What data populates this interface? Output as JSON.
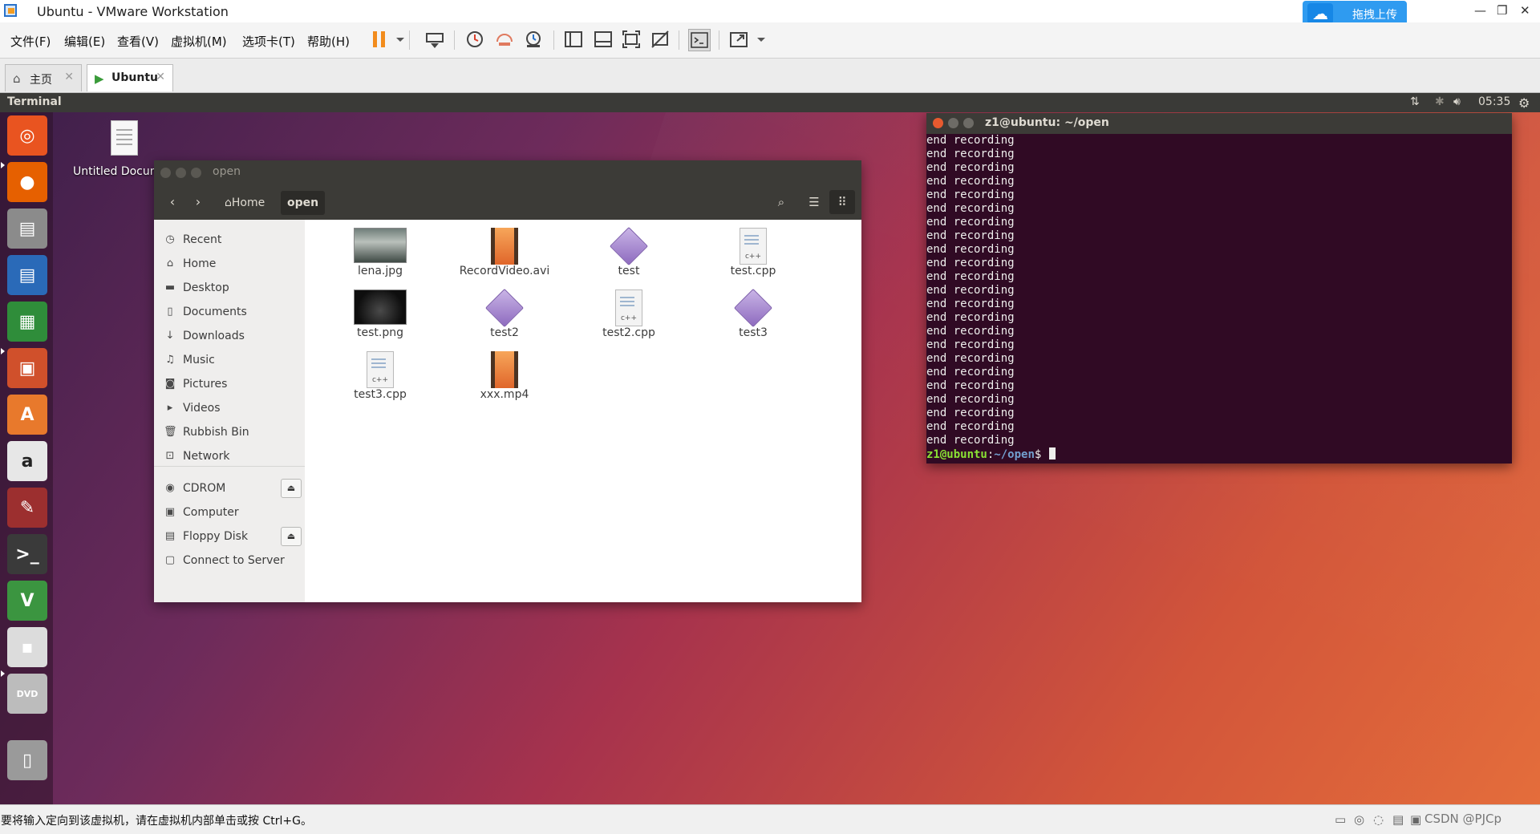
{
  "window": {
    "title": "Ubuntu - VMware Workstation",
    "upload_button": "拖拽上传",
    "controls": [
      "—",
      "❐",
      "✕"
    ]
  },
  "menu": {
    "items": [
      "文件(F)",
      "编辑(E)",
      "查看(V)",
      "虚拟机(M)",
      "选项卡(T)",
      "帮助(H)"
    ]
  },
  "tabs": [
    {
      "label": "主页",
      "icon": "home-icon",
      "close": "✕"
    },
    {
      "label": "Ubuntu",
      "icon": "vm-icon",
      "close": "✕"
    }
  ],
  "ubuntu_panel": {
    "app_title": "Terminal",
    "time": "05:35"
  },
  "desktop": {
    "file_label": "Untitled Docum"
  },
  "launcher": [
    {
      "name": "ubuntu-dash",
      "color": "#e95420"
    },
    {
      "name": "firefox",
      "color": "#e66000"
    },
    {
      "name": "files",
      "color": "#8b8b8b"
    },
    {
      "name": "libreoffice-writer",
      "color": "#2a6ab8"
    },
    {
      "name": "libreoffice-calc",
      "color": "#2f8d3a"
    },
    {
      "name": "libreoffice-impress",
      "color": "#d0502b"
    },
    {
      "name": "software-center",
      "color": "#e8792c"
    },
    {
      "name": "amazon",
      "color": "#e7e7e7"
    },
    {
      "name": "system-settings",
      "color": "#9c2f2f"
    },
    {
      "name": "terminal",
      "color": "#3a3a3a"
    },
    {
      "name": "vim",
      "color": "#3b9540"
    },
    {
      "name": "floppy",
      "color": "#dcdcdc"
    },
    {
      "name": "dvd",
      "color": "#bcbcbc"
    },
    {
      "name": "trash",
      "color": "#9a9a9a"
    }
  ],
  "files_window": {
    "title": "open",
    "breadcrumbs": [
      "Home",
      "open"
    ],
    "sidebar": [
      {
        "label": "Recent",
        "icon": "clock-icon"
      },
      {
        "label": "Home",
        "icon": "home-icon"
      },
      {
        "label": "Desktop",
        "icon": "folder-icon"
      },
      {
        "label": "Documents",
        "icon": "document-icon"
      },
      {
        "label": "Downloads",
        "icon": "download-icon"
      },
      {
        "label": "Music",
        "icon": "music-icon"
      },
      {
        "label": "Pictures",
        "icon": "camera-icon"
      },
      {
        "label": "Videos",
        "icon": "video-icon"
      },
      {
        "label": "Rubbish Bin",
        "icon": "trash-icon"
      },
      {
        "label": "Network",
        "icon": "network-icon"
      }
    ],
    "devices": [
      {
        "label": "CDROM",
        "icon": "disc-icon",
        "eject": true
      },
      {
        "label": "Computer",
        "icon": "computer-icon",
        "eject": false
      },
      {
        "label": "Floppy Disk",
        "icon": "floppy-icon",
        "eject": true
      },
      {
        "label": "Connect to Server",
        "icon": "server-icon",
        "eject": false
      }
    ],
    "files": [
      {
        "name": "lena.jpg",
        "type": "image-forest"
      },
      {
        "name": "RecordVideo.avi",
        "type": "video"
      },
      {
        "name": "test",
        "type": "executable"
      },
      {
        "name": "test.cpp",
        "type": "cpp"
      },
      {
        "name": "test.png",
        "type": "image-dark"
      },
      {
        "name": "test2",
        "type": "executable"
      },
      {
        "name": "test2.cpp",
        "type": "cpp"
      },
      {
        "name": "test3",
        "type": "executable"
      },
      {
        "name": "test3.cpp",
        "type": "cpp"
      },
      {
        "name": "xxx.mp4",
        "type": "video"
      }
    ]
  },
  "terminal": {
    "title": "z1@ubuntu: ~/open",
    "lines": [
      "end recording",
      "end recording",
      "end recording",
      "end recording",
      "end recording",
      "end recording",
      "end recording",
      "end recording",
      "end recording",
      "end recording",
      "end recording",
      "end recording",
      "end recording",
      "end recording",
      "end recording",
      "end recording",
      "end recording",
      "end recording",
      "end recording",
      "end recording",
      "end recording",
      "end recording",
      "end recording"
    ],
    "prompt_user": "z1@ubuntu",
    "prompt_sep": ":",
    "prompt_path": "~/open",
    "prompt_end": "$"
  },
  "statusbar": {
    "text": "要将输入定向到该虚拟机，请在虚拟机内部单击或按 Ctrl+G。",
    "watermark": "CSDN @PJCp"
  }
}
